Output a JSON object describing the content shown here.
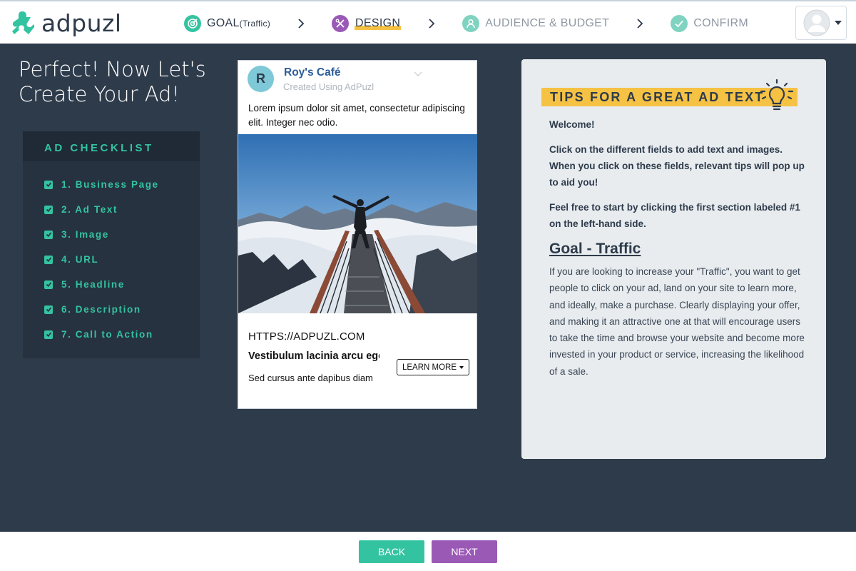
{
  "brand": {
    "name": "adpuzl",
    "accent": "#34c3a0",
    "purple": "#9b59b6",
    "highlight": "#f6c244",
    "dark": "#2e3b4b"
  },
  "steps": [
    {
      "label": "GOAL",
      "sublabel": "(Traffic)",
      "state": "done",
      "icon": "target-icon"
    },
    {
      "label": "DESIGN",
      "state": "active",
      "icon": "design-tools-icon"
    },
    {
      "label": "AUDIENCE & BUDGET",
      "state": "pending",
      "icon": "user-icon"
    },
    {
      "label": "CONFIRM",
      "state": "pending",
      "icon": "check-icon"
    }
  ],
  "page_title": "Perfect! Now Let's Create Your Ad!",
  "checklist": {
    "title": "AD CHECKLIST",
    "items": [
      "1. Business Page",
      "2. Ad Text",
      "3. Image",
      "4. URL",
      "5. Headline",
      "6. Description",
      "7. Call to Action"
    ]
  },
  "ad": {
    "avatar_letter": "R",
    "page_name": "Roy's Café",
    "created_with": "Created Using AdPuzl",
    "text": "Lorem ipsum dolor sit amet, consectetur adipiscing elit. Integer nec odio.",
    "url": "HTTPS://ADPUZL.COM",
    "headline": "Vestibulum lacinia arcu eget nulla",
    "description": "Sed cursus ante dapibus diam",
    "cta": "LEARN MORE"
  },
  "tips": {
    "title": "TIPS FOR A GREAT AD TEXT",
    "welcome": "Welcome!",
    "p1": "Click on the different fields to add text and images. When you click on these fields, relevant tips will pop up to aid you!",
    "p2": "Feel free to start by clicking the first section labeled #1 on the left-hand side.",
    "goal_title": "Goal - Traffic",
    "goal_text": "If you are looking to increase your \"Traffic\", you want to get people to click on your ad, land on your site to learn more, and ideally, make a purchase. Clearly displaying your offer, and making it an attractive one at that will encourage users to take the time and browse your website and become more invested in your product or service, increasing the likelihood of a sale."
  },
  "nav": {
    "back": "BACK",
    "next": "NEXT"
  }
}
